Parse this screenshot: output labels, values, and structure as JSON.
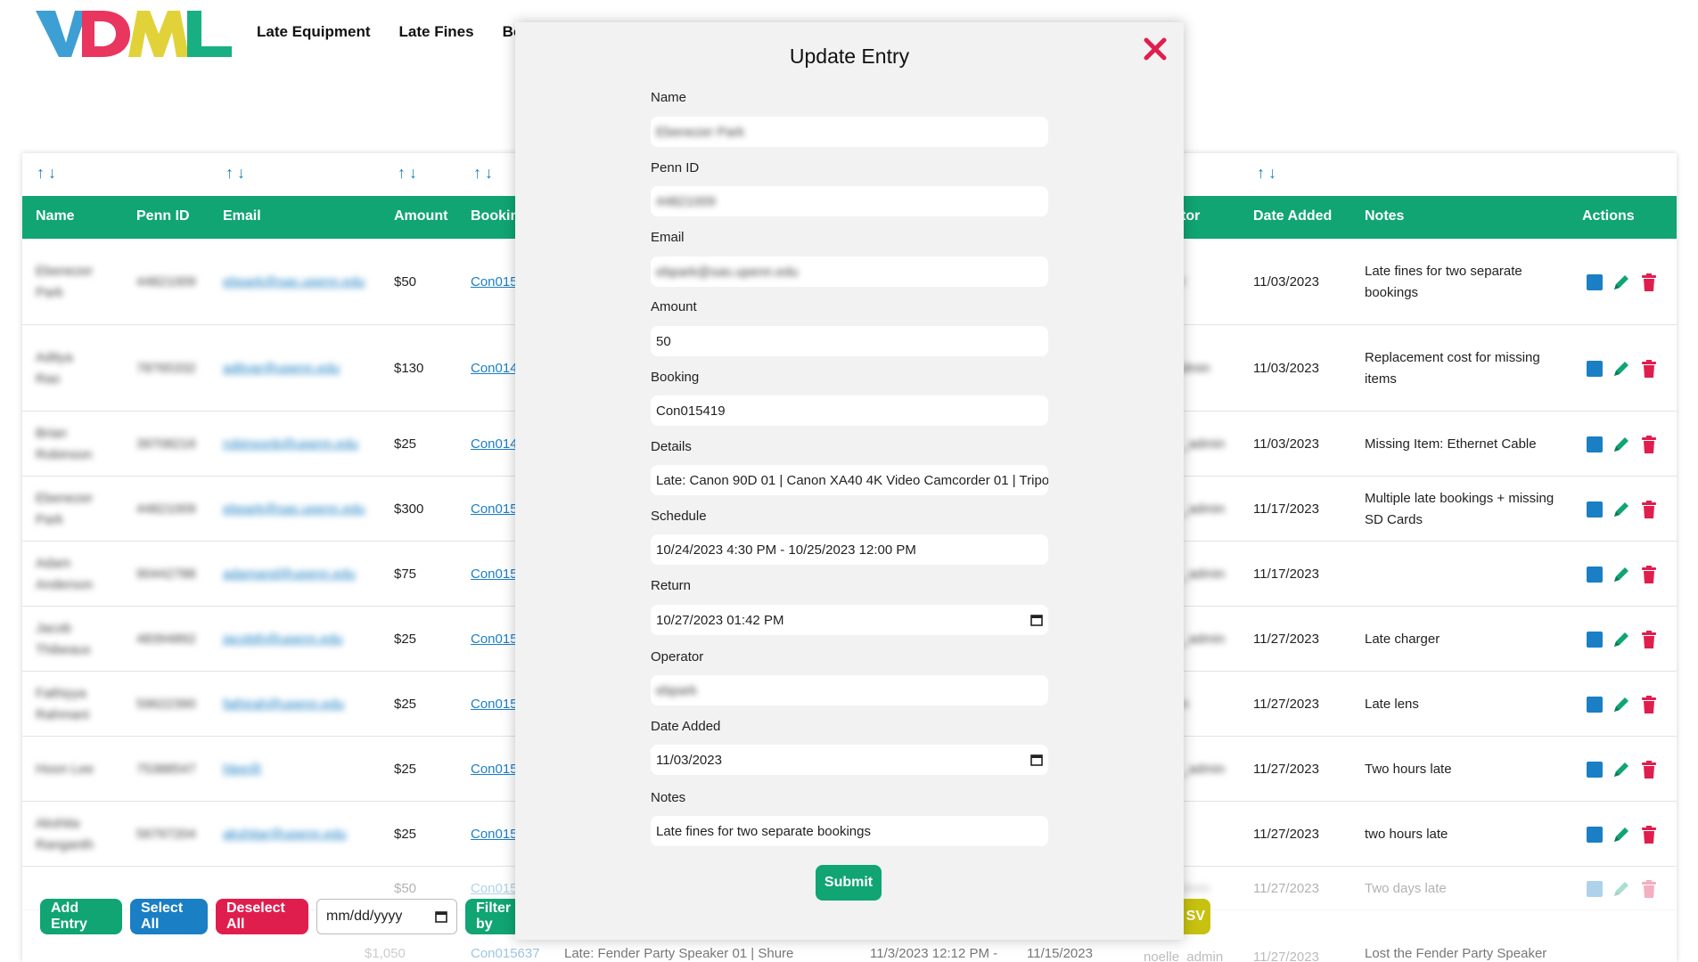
{
  "header": {
    "logo_text": "VDML",
    "nav": [
      "Late Equipment",
      "Late Fines",
      "Booki"
    ]
  },
  "table": {
    "headers": {
      "name": "Name",
      "penn_id": "Penn ID",
      "email": "Email",
      "amount": "Amount",
      "booking": "Booking",
      "operator": "tor",
      "date_added": "Date Added",
      "notes": "Notes",
      "actions": "Actions"
    },
    "rows": [
      {
        "name": "Ebenezer Park",
        "penn_id": "44821009",
        "email": "ebpark@sas.upenn.edu",
        "amount": "$50",
        "booking": "Con015",
        "operator": "r",
        "date_added": "11/03/2023",
        "notes": "Late fines for two separate bookings"
      },
      {
        "name": "Aditya Rao",
        "penn_id": "78765332",
        "email": "adityar@upenn.edu",
        "amount": "$130",
        "booking": "Con014",
        "operator": "dmin",
        "date_added": "11/03/2023",
        "notes": "Replacement cost for missing items"
      },
      {
        "name": "Brian Robinson",
        "penn_id": "39708216",
        "email": "robinsonb@upenn.edu",
        "amount": "$25",
        "booking": "Con014",
        "operator": "_admin",
        "date_added": "11/03/2023",
        "notes": "Missing Item: Ethernet Cable"
      },
      {
        "name": "Ebenezer Park",
        "penn_id": "44821009",
        "email": "ebpark@sas.upenn.edu",
        "amount": "$300",
        "booking": "Con015",
        "operator": "_admin",
        "date_added": "11/17/2023",
        "notes": "Multiple late bookings + missing SD Cards"
      },
      {
        "name": "Adam Anderson",
        "penn_id": "90442788",
        "email": "adamand@upenn.edu",
        "amount": "$75",
        "booking": "Con015",
        "operator": "_admin",
        "date_added": "11/17/2023",
        "notes": ""
      },
      {
        "name": "Jacob Thibeaux",
        "penn_id": "48394892",
        "email": "jacobth@upenn.edu",
        "amount": "$25",
        "booking": "Con015",
        "operator": "_admin",
        "date_added": "11/27/2023",
        "notes": "Late charger"
      },
      {
        "name": "Fathiyya Rahmani",
        "penn_id": "59622390",
        "email": "fathirah@upenn.edu",
        "amount": "$25",
        "booking": "Con015",
        "operator": "n",
        "date_added": "11/27/2023",
        "notes": "Late lens"
      },
      {
        "name": "Hoon Lee",
        "penn_id": "75388547",
        "email": "hlee@",
        "amount": "$25",
        "booking": "Con015",
        "operator": "_admin",
        "date_added": "11/27/2023",
        "notes": "Two hours late"
      },
      {
        "name": "Akshita Ranganth",
        "penn_id": "56797204",
        "email": "akshitar@upenn.edu",
        "amount": "$25",
        "booking": "Con015",
        "operator": "",
        "date_added": "11/27/2023",
        "notes": "two hours late"
      },
      {
        "name": "",
        "penn_id": "",
        "email": "",
        "amount": "$50",
        "booking": "Con015",
        "operator": "dmin",
        "date_added": "11/27/2023",
        "notes": "Two days late"
      }
    ],
    "partial_row": {
      "amount": "$1,050",
      "booking": "Con015637",
      "details": "Late: Fender Party Speaker 01 | Shure",
      "schedule": "11/3/2023 12:12 PM -",
      "return": "11/15/2023",
      "operator": "noelle_admin",
      "date_added": "11/27/2023",
      "notes": "Lost the Fender Party Speaker"
    }
  },
  "toolbar": {
    "add_entry": "Add Entry",
    "select_all": "Select All",
    "deselect_all": "Deselect All",
    "date_placeholder": "mm/dd/yyyy",
    "filter": "Filter by",
    "export": "SV"
  },
  "modal": {
    "title": "Update Entry",
    "fields": {
      "name_label": "Name",
      "name_value": "Ebenezer Park",
      "pennid_label": "Penn ID",
      "pennid_value": "44821009",
      "email_label": "Email",
      "email_value": "ebpark@sas.upenn.edu",
      "amount_label": "Amount",
      "amount_value": "50",
      "booking_label": "Booking",
      "booking_value": "Con015419",
      "details_label": "Details",
      "details_value": "Late: Canon 90D 01 | Canon XA40 4K Video Camcorder 01 | Tripo",
      "schedule_label": "Schedule",
      "schedule_value": "10/24/2023 4:30 PM - 10/25/2023 12:00 PM",
      "return_label": "Return",
      "return_value": "10/27/2023 01:42 PM",
      "operator_label": "Operator",
      "operator_value": "ebpark",
      "date_added_label": "Date Added",
      "date_added_value": "11/03/2023",
      "notes_label": "Notes",
      "notes_value": "Late fines for two separate bookings"
    },
    "submit": "Submit"
  },
  "colors": {
    "primary_green": "#10a572",
    "blue": "#1a7fc4",
    "red": "#e01e4e",
    "yellow": "#c7c20f",
    "modal_bg": "#f2f2f2"
  }
}
